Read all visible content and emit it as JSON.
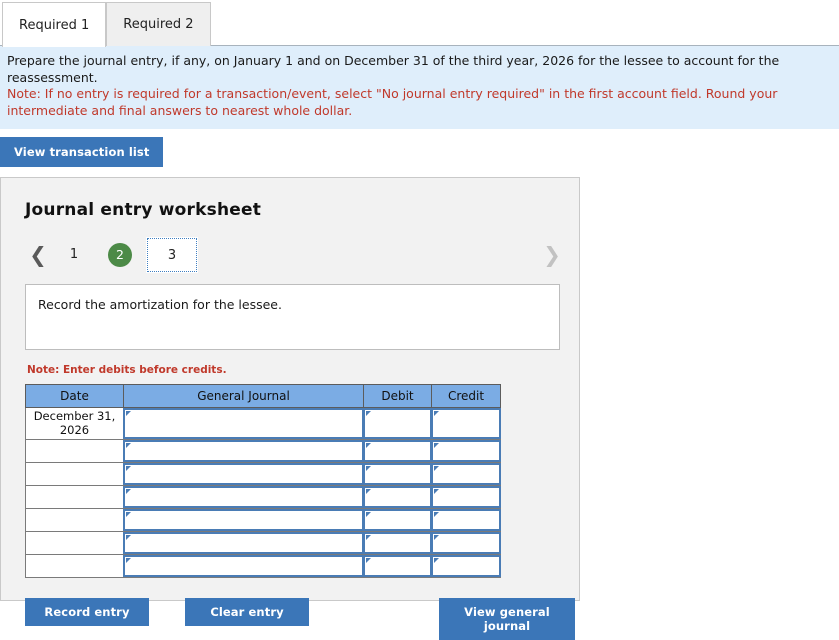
{
  "tabs": [
    {
      "label": "Required 1",
      "active": true
    },
    {
      "label": "Required 2",
      "active": false
    }
  ],
  "banner": {
    "instruction": "Prepare the journal entry, if any, on January 1 and on December 31 of the third year, 2026 for the lessee to account for the reassessment.",
    "note": "Note: If no entry is required for a transaction/event, select \"No journal entry required\" in the first account field. Round your intermediate and final answers to nearest whole dollar."
  },
  "toolbar": {
    "view_transaction_list": "View transaction list"
  },
  "panel": {
    "title": "Journal entry worksheet",
    "pager": {
      "prev_icon": "❮",
      "next_icon": "❯",
      "pages": [
        {
          "label": "1",
          "state": "plain"
        },
        {
          "label": "2",
          "state": "current"
        },
        {
          "label": "3",
          "state": "selected"
        }
      ]
    },
    "prompt": "Record the amortization for the lessee.",
    "note": "Note: Enter debits before credits.",
    "table": {
      "headers": [
        "Date",
        "General Journal",
        "Debit",
        "Credit"
      ],
      "rows": [
        {
          "date": "December 31, 2026",
          "general_journal": "",
          "debit": "",
          "credit": ""
        },
        {
          "date": "",
          "general_journal": "",
          "debit": "",
          "credit": ""
        },
        {
          "date": "",
          "general_journal": "",
          "debit": "",
          "credit": ""
        },
        {
          "date": "",
          "general_journal": "",
          "debit": "",
          "credit": ""
        },
        {
          "date": "",
          "general_journal": "",
          "debit": "",
          "credit": ""
        },
        {
          "date": "",
          "general_journal": "",
          "debit": "",
          "credit": ""
        },
        {
          "date": "",
          "general_journal": "",
          "debit": "",
          "credit": ""
        }
      ]
    },
    "buttons": {
      "record_entry": "Record entry",
      "clear_entry": "Clear entry",
      "view_general_journal": "View general journal"
    }
  },
  "colors": {
    "accent_blue": "#3b76b8",
    "table_header_blue": "#7bace4",
    "banner_blue": "#dfeefb",
    "current_page_green": "#4c8a47",
    "note_red": "#c0392b",
    "panel_gray": "#f2f2f2",
    "cell_border_blue": "#4a7cb5"
  }
}
